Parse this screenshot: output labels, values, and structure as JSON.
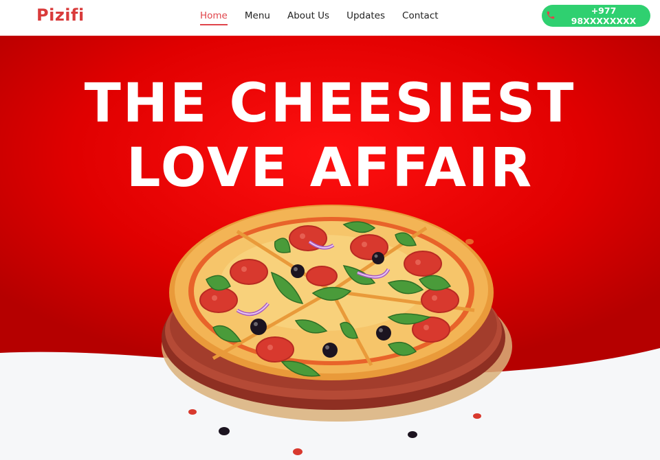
{
  "brand": {
    "name": "Pizifi"
  },
  "nav": {
    "items": [
      {
        "label": "Home",
        "active": true
      },
      {
        "label": "Menu",
        "active": false
      },
      {
        "label": "About Us",
        "active": false
      },
      {
        "label": "Updates",
        "active": false
      },
      {
        "label": "Contact",
        "active": false
      }
    ]
  },
  "contact": {
    "phone": "+977 98XXXXXXXX",
    "icon": "phone-icon",
    "button_color": "#2fd070"
  },
  "hero": {
    "title_line1": "THE CHEESIEST",
    "title_line2": "LOVE AFFAIR",
    "background_color": "#e00000",
    "image": "pizza-illustration"
  },
  "colors": {
    "brand": "#d93b3b",
    "accent": "#e0444a"
  }
}
